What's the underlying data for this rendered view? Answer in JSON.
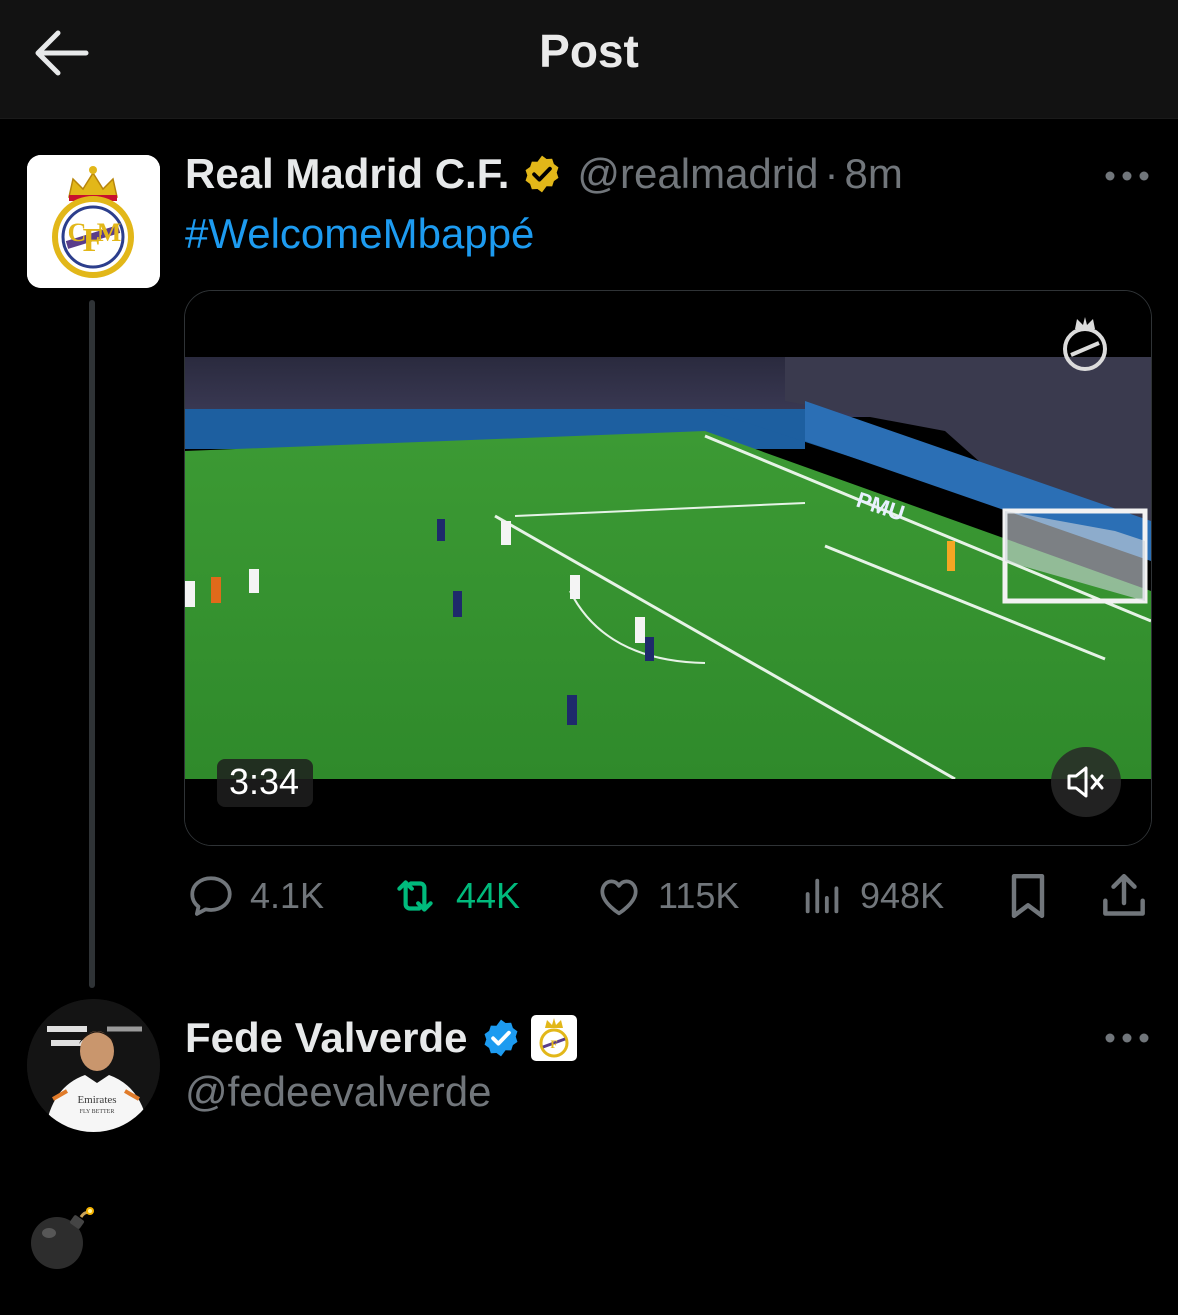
{
  "header": {
    "title": "Post",
    "back_icon": "arrow-left-icon"
  },
  "post": {
    "author": {
      "display_name": "Real Madrid C.F.",
      "handle": "@realmadrid",
      "verified_badge": "gold-verified-badge-icon",
      "avatar": "real-madrid-crest"
    },
    "separator": "·",
    "time": "8m",
    "text": "#WelcomeMbappé",
    "video": {
      "duration": "3:34",
      "mute_icon": "speaker-muted-icon",
      "watermark": "real-madrid-crest"
    },
    "stats": {
      "replies": "4.1K",
      "reposts": "44K",
      "likes": "115K",
      "views": "948K"
    }
  },
  "reply": {
    "author": {
      "display_name": "Fede Valverde",
      "handle": "@fedeevalverde",
      "verified_badge": "blue-verified-badge-icon",
      "affiliate_badge": "real-madrid-crest"
    },
    "text": "💣"
  },
  "colors": {
    "background": "#000000",
    "header_bg": "#121212",
    "primary_text": "#e7e9ea",
    "secondary_text": "#71767b",
    "link": "#1d9bf0",
    "repost_active": "#00ba7c",
    "gold_badge": "#e2b719",
    "blue_badge": "#1d9bf0"
  }
}
